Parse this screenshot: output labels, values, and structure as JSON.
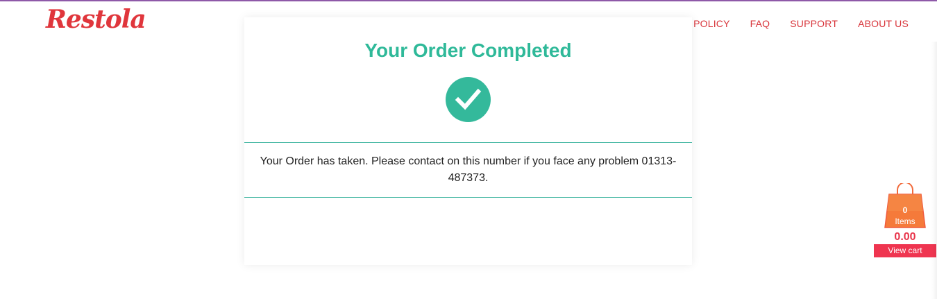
{
  "brand": {
    "name": "Restola",
    "color": "#e0363c"
  },
  "nav": {
    "items": [
      {
        "label": "PRIVACY POLICY"
      },
      {
        "label": "FAQ"
      },
      {
        "label": "SUPPORT"
      },
      {
        "label": "ABOUT US"
      }
    ]
  },
  "order": {
    "title": "Your Order Completed",
    "icon": "check-circle-icon",
    "message": "Your Order has taken. Please contact on this number if you face any problem 01313-487373.",
    "accent": "#2fb999"
  },
  "cart": {
    "icon": "shopping-bag-icon",
    "count": "0",
    "items_label": "Items",
    "total": "0.00",
    "view_label": "View cart",
    "accent": "#ef3550"
  }
}
